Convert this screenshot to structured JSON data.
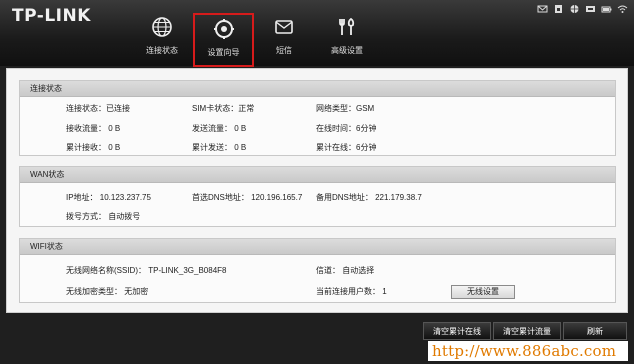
{
  "brand": {
    "logo_text": "TP-LINK"
  },
  "nav": [
    {
      "label": "连接状态",
      "icon": "globe-icon"
    },
    {
      "label": "设置向导",
      "icon": "settings-icon"
    },
    {
      "label": "短信",
      "icon": "mail-icon"
    },
    {
      "label": "高级设置",
      "icon": "tools-icon"
    }
  ],
  "status_icons": [
    "sms-icon",
    "sim-icon",
    "globe-icon",
    "network-icon",
    "battery-icon",
    "wifi-icon"
  ],
  "connection": {
    "title": "连接状态",
    "state": "连接状态：已连接",
    "sim": "SIM卡状态：正常",
    "network_type": "网络类型：GSM",
    "rx": "接收流量：  0 B",
    "tx": "发送流量：  0 B",
    "online_time": "在线时间：6分钟",
    "total_rx": "累计接收：  0 B",
    "total_tx": "累计发送：  0 B",
    "total_online": "累计在线：6分钟"
  },
  "wan": {
    "title": "WAN状态",
    "ip": "IP地址：  10.123.237.75",
    "primary_dns": "首选DNS地址：  120.196.165.7",
    "secondary_dns": "备用DNS地址：  221.179.38.7",
    "dial_mode": "拨号方式：  自动拨号"
  },
  "wifi": {
    "title": "WIFI状态",
    "ssid": "无线网络名称(SSID)：  TP-LINK_3G_B084F8",
    "channel": "信道：  自动选择",
    "encryption": "无线加密类型：  无加密",
    "users": "当前连接用户数：  1",
    "settings_button": "无线设置"
  },
  "actions": {
    "clear_online": "清空累计在线",
    "clear_traffic": "清空累计流量",
    "refresh": "刷新"
  },
  "watermark": "http://www.886abc.com",
  "colors": {
    "active_outline": "#d61b1b",
    "watermark": "#e07a00"
  }
}
